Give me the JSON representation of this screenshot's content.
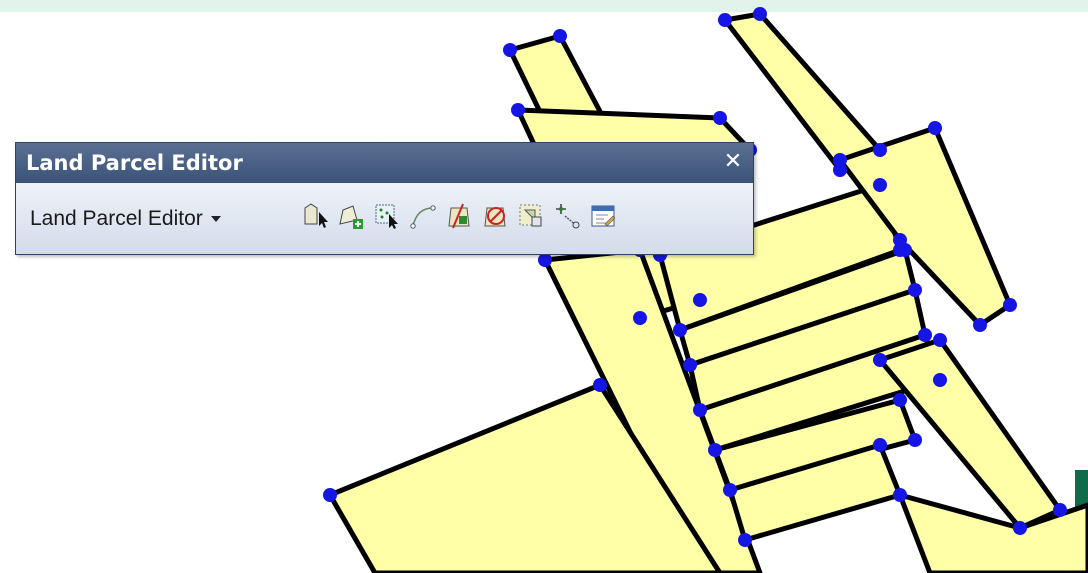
{
  "toolbar": {
    "title": "Land Parcel Editor",
    "close_glyph": "✕",
    "menu_label": "Land Parcel Editor",
    "tools": [
      {
        "name": "select-parcel-icon"
      },
      {
        "name": "new-parcel-icon"
      },
      {
        "name": "select-points-icon"
      },
      {
        "name": "curve-tool-icon"
      },
      {
        "name": "split-parcel-icon"
      },
      {
        "name": "delete-parcel-icon"
      },
      {
        "name": "parcel-extent-icon"
      },
      {
        "name": "move-point-icon"
      },
      {
        "name": "parcel-details-icon"
      }
    ]
  },
  "map": {
    "parcel_fill": "#ffffa8",
    "boundary_color": "#000000",
    "vertex_color": "#1515e6"
  }
}
